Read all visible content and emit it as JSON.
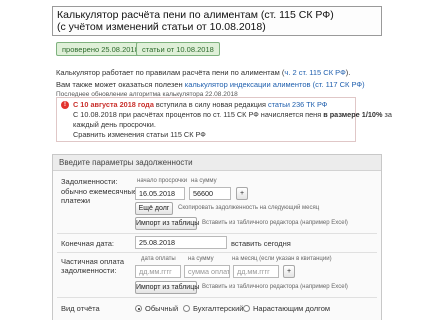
{
  "title": {
    "line1": "Калькулятор расчёта пени по алиментам (ст. 115 СК РФ)",
    "line2": "(с учётом изменений статьи от 10.08.2018)"
  },
  "badges": {
    "checked": "проверено 25.08.2018",
    "article": "статьи от 10.08.2018"
  },
  "intro": {
    "rules_prefix": "Калькулятор работает по правилам расчёта пени по алиментам (",
    "rules_link": "ч. 2 ст. 115 СК РФ",
    "rules_suffix": ").",
    "useful_prefix": "Вам также может оказаться полезен ",
    "useful_link": "калькулятор индексации алиментов (ст. 117 СК РФ)",
    "updated": "Последнее обновление алгоритма калькулятора 22.08.2018"
  },
  "notice": {
    "line1_date": "С 10 августа 2018 года",
    "line1_mid": " вступила в силу новая редакция ",
    "line1_link": "статьи 236 ТК РФ",
    "line2_prefix": "С 10.08.2018 при расчётах процентов по ст. 115 СК РФ начисляется пеня ",
    "line2_bold": "в размере 1/10%",
    "line2_suffix": " за",
    "line3": "каждый день просрочки.",
    "line4_link": "Сравнить изменения статьи 115 СК РФ"
  },
  "form": {
    "header": "Введите параметры задолженности",
    "debt": {
      "label": "Задолженности:",
      "sublabel1": "обычно ежемесячные",
      "sublabel2": "платежи",
      "hint_start": "начало просрочки",
      "hint_sum": "на сумму",
      "date_value": "16.05.2018",
      "sum_value": "56600",
      "plus_label": "+",
      "more_button": "Ещё долг",
      "more_hint": "Скопировать задолженность на следующий месяц",
      "import_button": "Импорт из таблицы",
      "import_hint": "Вставить из табличного редактора (например Excel)"
    },
    "end_date": {
      "label": "Конечная дата:",
      "value": "25.08.2018",
      "today_link": "вставить сегодня"
    },
    "partial": {
      "label1": "Частичная оплата",
      "label2": "задолженности:",
      "hint_date": "дата оплаты",
      "hint_sum": "на сумму",
      "hint_cause": "на месяц (если указан в квитанции)",
      "date_placeholder": "дд.мм.гггг",
      "sum_placeholder": "сумма оплаты",
      "month_placeholder": "дд.мм.гггг",
      "plus_label": "+",
      "import_button": "Импорт из таблицы",
      "import_hint": "Вставить из табличного редактора (например Excel)"
    },
    "report": {
      "label": "Вид отчёта",
      "options": [
        "Обычный",
        "Бухгалтерский",
        "Нарастающим долгом"
      ],
      "selected": 0
    }
  }
}
